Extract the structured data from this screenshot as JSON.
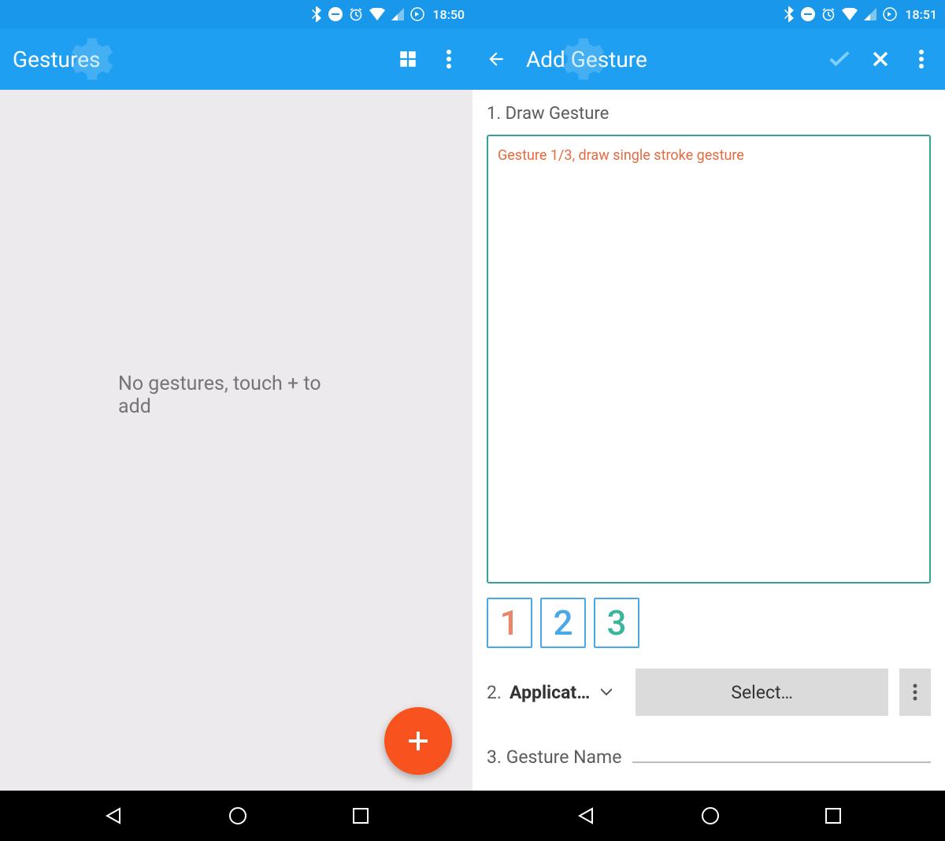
{
  "left": {
    "status": {
      "time": "18:50"
    },
    "appbar": {
      "title": "Gestures"
    },
    "emptyText": "No gestures, touch + to add"
  },
  "right": {
    "status": {
      "time": "18:51"
    },
    "appbar": {
      "title": "Add Gesture"
    },
    "step1": {
      "label": "1. Draw Gesture",
      "hint": "Gesture 1/3, draw single stroke gesture"
    },
    "counts": {
      "one": "1",
      "two": "2",
      "three": "3"
    },
    "step2": {
      "num": "2.",
      "label": "Applicat…",
      "selectLabel": "Select…"
    },
    "step3": {
      "label": "3.  Gesture Name"
    }
  }
}
